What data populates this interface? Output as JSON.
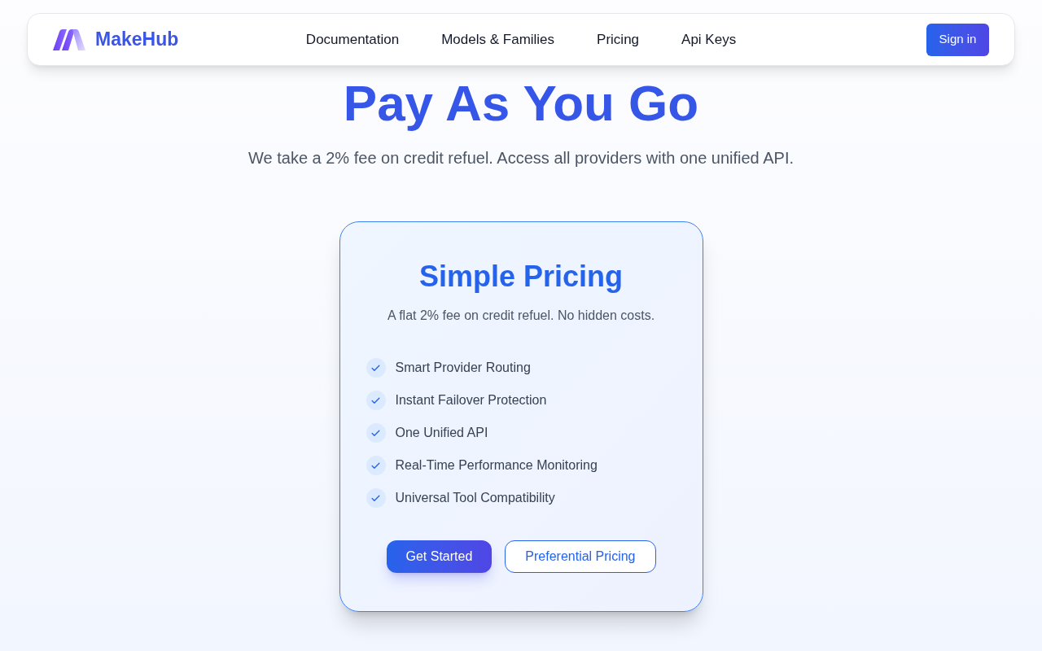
{
  "nav": {
    "brand": "MakeHub",
    "links": [
      {
        "label": "Documentation"
      },
      {
        "label": "Models & Families"
      },
      {
        "label": "Pricing"
      },
      {
        "label": "Api Keys"
      }
    ],
    "sign_in": "Sign in"
  },
  "hero": {
    "title": "Pay As You Go",
    "subtitle": "We take a 2% fee on credit refuel. Access all providers with one unified API."
  },
  "pricing_card": {
    "title": "Simple Pricing",
    "subtitle": "A flat 2% fee on credit refuel. No hidden costs.",
    "features": [
      "Smart Provider Routing",
      "Instant Failover Protection",
      "One Unified API",
      "Real-Time Performance Monitoring",
      "Universal Tool Compatibility"
    ],
    "buttons": [
      {
        "label": "Get Started",
        "kind": "primary"
      },
      {
        "label": "Preferential Pricing",
        "kind": "outline"
      }
    ]
  }
}
